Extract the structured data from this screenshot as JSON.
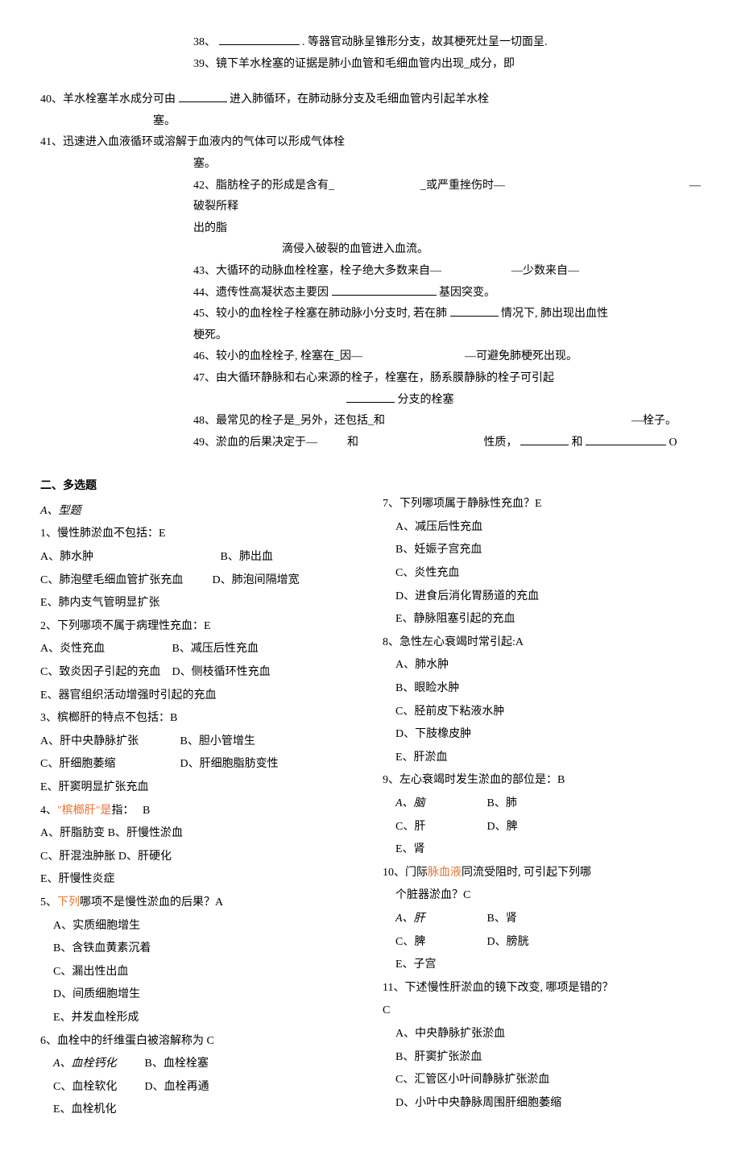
{
  "fills": {
    "q38": "38、",
    "q38b": ". 等器官动脉呈锥形分支，故其梗死灶呈一切面呈.",
    "q39": "39、镜下羊水栓塞的证据是肺小血管和毛细血管内出现_成分，即",
    "q40_a": "40、羊水栓塞羊水成分可由",
    "q40_b": "进入肺循环，在肺动脉分支及毛细血管内引起羊水栓",
    "q40_c": "塞。",
    "q41_a": "41、迅速进入血液循环或溶解于血液内的气体可以形成气体栓",
    "q41_b": "塞。",
    "q42_a": "42、脂肪栓子的形成是含有_",
    "q42_b": "_或严重挫伤时—",
    "q42_c": "—",
    "q42_d": "破裂所释",
    "q42_e": "出的脂",
    "q42_f": "滴侵入破裂的血管进入血流。",
    "q43_a": "43、大循环的动脉血栓栓塞，栓子绝大多数来自—",
    "q43_b": "—少数来自—",
    "q44_a": "44、遗传性高凝状态主要因",
    "q44_b": "基因突变。",
    "q45_a": "45、较小的血栓栓子栓塞在肺动脉小分支时, 若在肺",
    "q45_b": "情况下, 肺出现出血性",
    "q45_c": "梗死。",
    "q46_a": "46、较小的血栓栓子, 栓塞在_因—",
    "q46_b": "—可避免肺梗死出现。",
    "q47_a": "47、由大循环静脉和右心来源的栓子，栓塞在，肠系膜静脉的栓子可引起",
    "q47_b": "分支的栓塞",
    "q48_a": "48、最常见的栓子是_另外，还包括_和",
    "q48_b": "—栓子。",
    "q49_a": "49、淤血的后果决定于—",
    "q49_b": "和",
    "q49_c": "性质，",
    "q49_d": "和",
    "q49_e": "O"
  },
  "section2_title": "二、多选题",
  "typeA": "A、型题",
  "left": {
    "q1": "1、慢性肺淤血不包括：E",
    "q1a": "A、肺水肿",
    "q1b": "B、肺出血",
    "q1c": "C、肺泡壁毛细血管扩张充血",
    "q1d": "D、肺泡间隔增宽",
    "q1e": "E、肺内支气管明显扩张",
    "q2": "2、下列哪项不属于病理性充血：E",
    "q2a": "A、炎性充血",
    "q2b": "B、减压后性充血",
    "q2c": "C、致炎因子引起的充血",
    "q2d": "D、侧枝循环性充血",
    "q2e": "E、器官组织活动增强时引起的充血",
    "q3": "3、槟榔肝的特点不包括：B",
    "q3a": "A、肝中央静脉扩张",
    "q3b": "B、胆小管增生",
    "q3c": "C、肝细胞萎缩",
    "q3d": "D、肝细胞脂肪变性",
    "q3e": "E、肝窦明显扩张充血",
    "q4a1": "4、",
    "q4a2": "\"槟榔肝\"是",
    "q4a3": "指：",
    "q4a4": "B",
    "q4_a": "A、肝脂肪变 B、肝慢性淤血",
    "q4_c": "C、肝混浊肿胀 D、肝硬化",
    "q4_e": "E、肝慢性炎症",
    "q5a1": "5、",
    "q5a2": "下列",
    "q5a3": "哪项不是慢性淤血的后果？A",
    "q5_a": "A、实质细胞增生",
    "q5_b": "B、含铁血黄素沉着",
    "q5_c": "C、漏出性出血",
    "q5_d": "D、间质细胞增生",
    "q5_e": "E、并发血栓形成",
    "q6": "6、血栓中的纤维蛋白被溶解称为 C",
    "q6a": "A、血栓钙化",
    "q6b": "B、血栓栓塞",
    "q6c": "C、血栓软化",
    "q6d": "D、血栓再通",
    "q6e": "E、血栓机化"
  },
  "right": {
    "q7": "7、下列哪项属于静脉性充血？E",
    "q7a": "A、减压后性充血",
    "q7b": "B、妊娠子宫充血",
    "q7c": "C、炎性充血",
    "q7d": "D、进食后消化胃肠道的充血",
    "q7e": "E、静脉阻塞引起的充血",
    "q8": "8、急性左心衰竭时常引起:A",
    "q8a": "A、肺水肿",
    "q8b": "B、眼睑水肿",
    "q8c": "C、胫前皮下粘液水肿",
    "q8d": "D、下肢橡皮肿",
    "q8e": "E、肝淤血",
    "q9": "9、左心衰竭时发生淤血的部位是：B",
    "q9a": "A、脑",
    "q9b": "B、肺",
    "q9c": "C、肝",
    "q9d": "D、脾",
    "q9e": "E、肾",
    "q10": "10、门际",
    "q10x": "脉血液",
    "q10y": "同流受阻时, 可引起下列哪",
    "q10_2": "个脏器淤血？C",
    "q10a": "A、肝",
    "q10b": "B、肾",
    "q10c": "C、脾",
    "q10d": "D、膀胱",
    "q10e": "E、子宫",
    "q11": "11、下述慢性肝淤血的镜下改变, 哪项是错的？",
    "q11ans": "C",
    "q11a": "A、中央静脉扩张淤血",
    "q11b": "B、肝窦扩张淤血",
    "q11c": "C、汇管区小叶间静脉扩张淤血",
    "q11d": "D、小叶中央静脉周围肝细胞萎缩"
  }
}
